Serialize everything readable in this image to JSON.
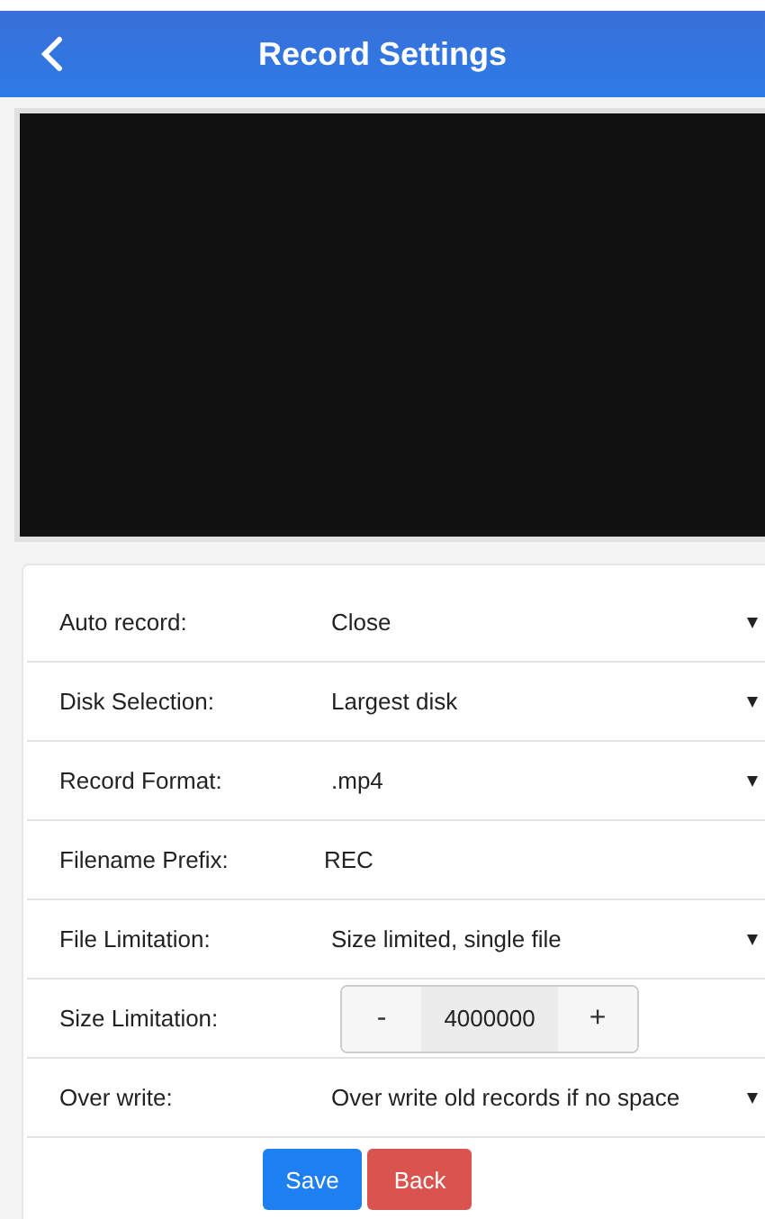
{
  "header": {
    "title": "Record Settings"
  },
  "settings": [
    {
      "kind": "select",
      "label": "Auto record:",
      "value": "Close"
    },
    {
      "kind": "select",
      "label": "Disk Selection:",
      "value": "Largest disk"
    },
    {
      "kind": "select",
      "label": "Record Format:",
      "value": ".mp4"
    },
    {
      "kind": "text",
      "label": "Filename Prefix:",
      "value": "REC"
    },
    {
      "kind": "select",
      "label": "File Limitation:",
      "value": "Size limited, single file"
    },
    {
      "kind": "stepper",
      "label": "Size Limitation:",
      "value": "4000000",
      "minus": "-",
      "plus": "+"
    },
    {
      "kind": "select",
      "label": "Over write:",
      "value": "Over write old records if no space"
    }
  ],
  "buttons": [
    {
      "kind": "primary",
      "label": "Save"
    },
    {
      "kind": "danger",
      "label": "Back"
    }
  ]
}
